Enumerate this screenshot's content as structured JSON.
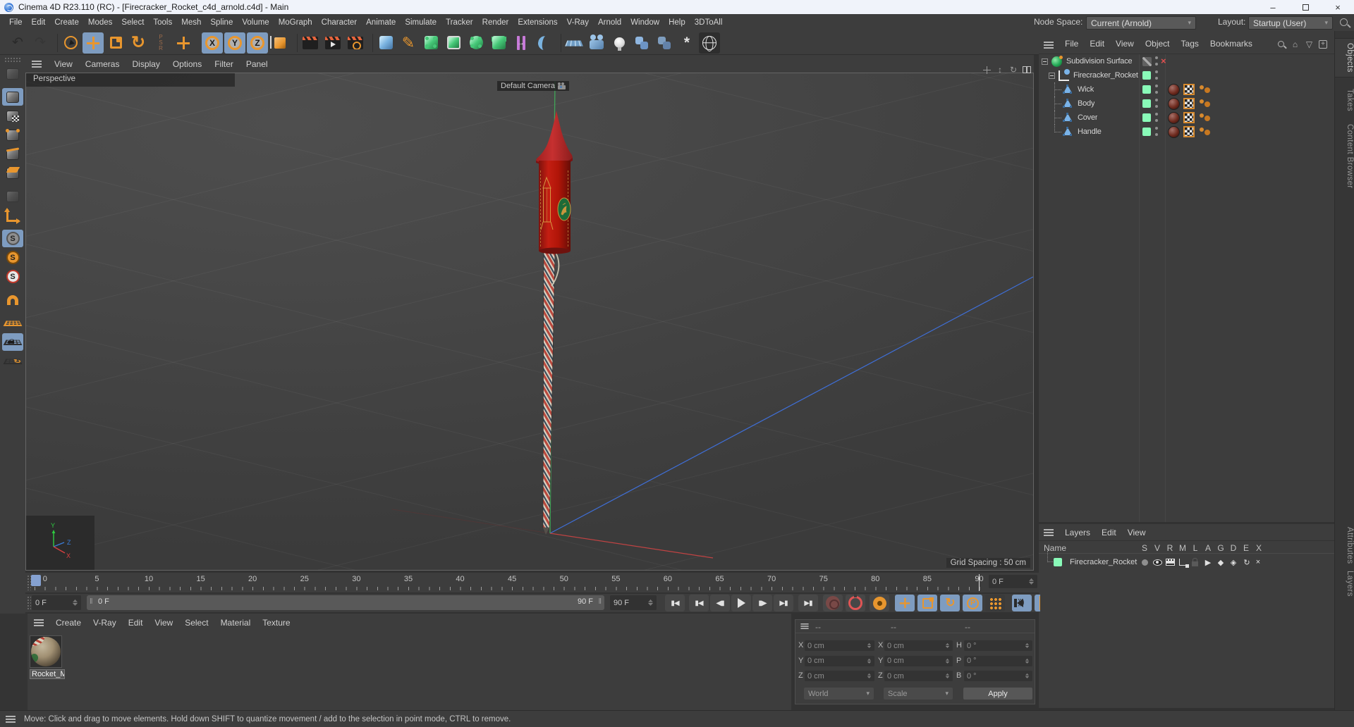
{
  "title_bar": {
    "title": "Cinema 4D R23.110 (RC) - [Firecracker_Rocket_c4d_arnold.c4d] - Main",
    "minimize": "–",
    "close": "×"
  },
  "menu_bar": {
    "items": [
      "File",
      "Edit",
      "Create",
      "Modes",
      "Select",
      "Tools",
      "Mesh",
      "Spline",
      "Volume",
      "MoGraph",
      "Character",
      "Animate",
      "Simulate",
      "Tracker",
      "Render",
      "Extensions",
      "V-Ray",
      "Arnold",
      "Window",
      "Help",
      "3DToAll"
    ],
    "node_space_label": "Node Space:",
    "node_space_value": "Current (Arnold)",
    "layout_label": "Layout:",
    "layout_value": "Startup (User)"
  },
  "toolbar": {
    "icons": [
      {
        "name": "undo-icon",
        "cls": "k-undo"
      },
      {
        "name": "redo-icon",
        "cls": "k-redo"
      },
      {
        "name": "toolbar-separator",
        "cls": "k-sep"
      },
      {
        "name": "live-selection-icon",
        "cls": "k-live-selection"
      },
      {
        "name": "move-tool-icon",
        "cls": "k-move sel"
      },
      {
        "name": "scale-tool-icon",
        "cls": "k-scale"
      },
      {
        "name": "rotate-tool-icon",
        "cls": "k-rotate"
      },
      {
        "name": "coord-psr-icon",
        "cls": "k-coord-psr"
      },
      {
        "name": "last-tool-icon",
        "cls": "k-last-tool"
      },
      {
        "name": "toolbar-separator",
        "cls": "k-sep2"
      },
      {
        "name": "lock-x-axis-icon",
        "cls": "k-lock-x sel",
        "letter": "X"
      },
      {
        "name": "lock-y-axis-icon",
        "cls": "k-lock-y sel",
        "letter": "Y"
      },
      {
        "name": "lock-z-axis-icon",
        "cls": "k-lock-z sel",
        "letter": "Z"
      },
      {
        "name": "coordinate-system-icon",
        "cls": "k-coordinate-system"
      },
      {
        "name": "toolbar-separator",
        "cls": "k-sep"
      },
      {
        "name": "render-view-icon",
        "cls": "k-render-view"
      },
      {
        "name": "render-to-picture-viewer-icon",
        "cls": "k-render-picture"
      },
      {
        "name": "edit-render-settings-icon",
        "cls": "k-render-settings"
      },
      {
        "name": "toolbar-separator",
        "cls": "k-sep"
      },
      {
        "name": "add-cube-icon",
        "cls": "k-add-cube"
      },
      {
        "name": "spline-pen-icon",
        "cls": "k-spline-pen"
      },
      {
        "name": "subdivision-surface-icon",
        "cls": "k-sds"
      },
      {
        "name": "extrude-icon",
        "cls": "k-extrude"
      },
      {
        "name": "cloner-icon",
        "cls": "k-cloner"
      },
      {
        "name": "array-icon",
        "cls": "k-array"
      },
      {
        "name": "symmetry-icon",
        "cls": "k-symmetry"
      },
      {
        "name": "bend-icon",
        "cls": "k-bend"
      },
      {
        "name": "toolbar-separator",
        "cls": "k-sep"
      },
      {
        "name": "floor-icon",
        "cls": "k-floor"
      },
      {
        "name": "camera-icon",
        "cls": "k-camera"
      },
      {
        "name": "light-icon",
        "cls": "k-light"
      },
      {
        "name": "python-generator-icon",
        "cls": "k-python1"
      },
      {
        "name": "python-tag-icon",
        "cls": "k-python2"
      },
      {
        "name": "xpresso-icon",
        "cls": "k-xpresso"
      },
      {
        "name": "content-browser-icon",
        "cls": "k-content-browser"
      }
    ]
  },
  "mode_toolbar": {
    "icons": [
      {
        "name": "make-editable-icon",
        "cls": "k-editable dim"
      },
      {
        "name": "model-mode-icon",
        "cls": "k-model sel gap"
      },
      {
        "name": "texture-mode-icon",
        "cls": "k-texture"
      },
      {
        "name": "points-mode-icon",
        "cls": "k-points"
      },
      {
        "name": "edges-mode-icon",
        "cls": "k-edges"
      },
      {
        "name": "polygons-mode-icon",
        "cls": "k-polygons"
      },
      {
        "name": "tweak-mode-icon",
        "cls": "k-tweak dim gap"
      },
      {
        "name": "axis-mode-icon",
        "cls": "k-axismode"
      },
      {
        "name": "enable-snap-icon",
        "cls": "k-snap sel gap"
      },
      {
        "name": "snap-modes-icon",
        "cls": "k-snap2"
      },
      {
        "name": "snap-settings-icon",
        "cls": "k-snap3"
      },
      {
        "name": "magnet-icon",
        "cls": "k-magnet gap"
      },
      {
        "name": "workplane-icon",
        "cls": "k-workplane gap"
      },
      {
        "name": "lock-workplane-icon",
        "cls": "k-lockplane sel"
      },
      {
        "name": "workplane-transform-icon",
        "cls": "k-rotplane"
      }
    ]
  },
  "viewport": {
    "menu": [
      "View",
      "Cameras",
      "Display",
      "Options",
      "Filter",
      "Panel"
    ],
    "label": "Perspective",
    "camera_label": "Default Camera",
    "grid_spacing": "Grid Spacing : 50 cm",
    "axis_x": "X",
    "axis_y": "Y",
    "axis_z": "Z"
  },
  "object_manager": {
    "menu": [
      "File",
      "Edit",
      "View",
      "Object",
      "Tags",
      "Bookmarks"
    ],
    "tree": [
      {
        "label": "Subdivision Surface",
        "cls": "row-sds",
        "name": "tree-row-subdivision-surface"
      },
      {
        "label": "Firecracker_Rocket",
        "cls": "row-null",
        "name": "tree-row-firecracker-rocket"
      },
      {
        "label": "Wick",
        "cls": "row-poly",
        "name": "tree-row-wick"
      },
      {
        "label": "Body",
        "cls": "row-poly",
        "name": "tree-row-body"
      },
      {
        "label": "Cover",
        "cls": "row-poly",
        "name": "tree-row-cover"
      },
      {
        "label": "Handle",
        "cls": "row-poly row-last",
        "name": "tree-row-handle"
      }
    ]
  },
  "layer_manager": {
    "menu": [
      "Layers",
      "Edit",
      "View"
    ],
    "name_header": "Name",
    "columns": [
      "S",
      "V",
      "R",
      "M",
      "L",
      "A",
      "G",
      "D",
      "E",
      "X"
    ],
    "row_label": "Firecracker_Rocket"
  },
  "right_tabs": {
    "top": [
      {
        "label": "Objects",
        "cls": "active",
        "name": "tab-objects"
      },
      {
        "label": "Takes",
        "cls": "",
        "name": "tab-takes"
      },
      {
        "label": "Content Browser",
        "cls": "",
        "name": "tab-content-browser"
      }
    ],
    "bottom": [
      {
        "label": "Attributes",
        "cls": "",
        "name": "tab-attributes"
      },
      {
        "label": "Layers",
        "cls": "",
        "name": "tab-layers"
      }
    ]
  },
  "timeline": {
    "ticks": [
      "0",
      "5",
      "10",
      "15",
      "20",
      "25",
      "30",
      "35",
      "40",
      "45",
      "50",
      "55",
      "60",
      "65",
      "70",
      "75",
      "80",
      "85",
      "90"
    ],
    "frame_field": "0 F",
    "current_frame": "0 F",
    "slider_start": "0 F",
    "slider_end": "90 F",
    "end_frame": "90 F"
  },
  "transport": [
    {
      "name": "go-to-start-button",
      "g": "▮◀",
      "cls": ""
    },
    {
      "name": "go-to-previous-key-button",
      "g": "▮◀",
      "cls": "ml6"
    },
    {
      "name": "go-to-previous-frame-button",
      "g": "◀▮",
      "cls": ""
    },
    {
      "name": "play-button",
      "g": "",
      "cls": "isplay"
    },
    {
      "name": "go-to-next-frame-button",
      "g": "▮▶",
      "cls": ""
    },
    {
      "name": "go-to-next-key-button",
      "g": "▶▮",
      "cls": ""
    },
    {
      "name": "go-to-end-button",
      "g": "▶▮",
      "cls": "ml7"
    },
    {
      "name": "record-keyframe-button",
      "g": "",
      "cls": "isredkey ml7"
    },
    {
      "name": "autokeying-button",
      "g": "",
      "cls": "isautokey ml4"
    },
    {
      "name": "keying-options-button",
      "g": "",
      "cls": "isgear ml6"
    },
    {
      "name": "key-position-button",
      "g": "",
      "cls": "ismove bluebg ml8"
    },
    {
      "name": "key-scale-button",
      "g": "",
      "cls": "isscale bluebg ml4"
    },
    {
      "name": "key-rotation-button",
      "g": "",
      "cls": "isrot bluebg ml4"
    },
    {
      "name": "key-parameter-button",
      "g": "",
      "cls": "ispring bluebg ml4"
    },
    {
      "name": "key-pla-button",
      "g": "",
      "cls": "isdots darkbg ml4"
    },
    {
      "name": "play-sound-button",
      "g": "",
      "cls": "isspk bluebg ml10"
    },
    {
      "name": "render-preview-button",
      "g": "",
      "cls": "isfilm bluebg ml4"
    }
  ],
  "materials": {
    "menu": [
      "Create",
      "V-Ray",
      "Edit",
      "View",
      "Select",
      "Material",
      "Texture"
    ],
    "item_label": "Rocket_M"
  },
  "coordinates": {
    "dash1": "--",
    "dash2": "--",
    "dash3": "--",
    "rows": [
      {
        "l1": "X",
        "v1": "0 cm",
        "l2": "X",
        "v2": "0 cm",
        "l3": "H",
        "v3": "0 °"
      },
      {
        "l1": "Y",
        "v1": "0 cm",
        "l2": "Y",
        "v2": "0 cm",
        "l3": "P",
        "v3": "0 °"
      },
      {
        "l1": "Z",
        "v1": "0 cm",
        "l2": "Z",
        "v2": "0 cm",
        "l3": "B",
        "v3": "0 °"
      }
    ],
    "dropdown1": "World",
    "dropdown2": "Scale",
    "apply": "Apply"
  },
  "status_bar": {
    "message": "Move: Click and drag to move elements. Hold down SHIFT to quantize movement / add to the selection in point mode, CTRL to remove."
  }
}
